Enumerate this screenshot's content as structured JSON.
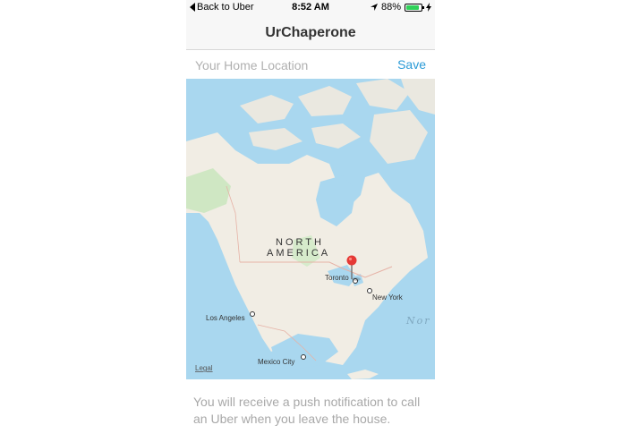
{
  "status_bar": {
    "back_label": "Back to Uber",
    "time": "8:52 AM",
    "battery_percent": "88%",
    "battery_level": 0.88,
    "battery_color": "#2fd158"
  },
  "nav": {
    "title": "UrChaperone"
  },
  "location": {
    "placeholder": "Your Home Location",
    "save_label": "Save",
    "accent_color": "#2b9bd7"
  },
  "map": {
    "region_label_1": "NORTH",
    "region_label_2": "AMERICA",
    "ocean_label": "Nor",
    "legal_label": "Legal",
    "pin_color": "#e53935",
    "cities": {
      "toronto": "Toronto",
      "new_york": "New York",
      "los_angeles": "Los Angeles",
      "mexico_city": "Mexico City"
    }
  },
  "caption": "You will receive a push notification to call an Uber when you leave the house."
}
